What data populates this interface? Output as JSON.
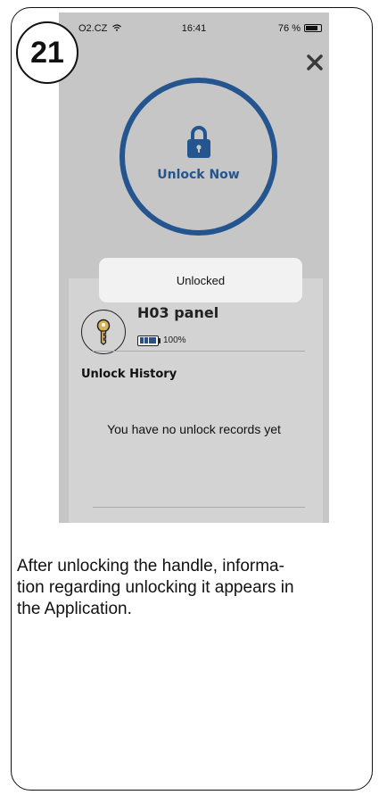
{
  "step": {
    "number": "21"
  },
  "status_bar": {
    "carrier": "O2.CZ",
    "time": "16:41",
    "battery": "76 %"
  },
  "unlock": {
    "label": "Unlock Now"
  },
  "toast": {
    "text": "Unlocked"
  },
  "device": {
    "name": "H03 panel",
    "battery_percent": "100%",
    "battery_level": 1.0
  },
  "history": {
    "title": "Unlock History",
    "empty_text": "You have no unlock records yet"
  },
  "caption": {
    "lines": [
      "After unlocking the handle, informa-",
      "tion regarding unlocking it appears in",
      "the Application."
    ]
  },
  "colors": {
    "accent": "#24558f",
    "screen_overlay": "#c6c6c6",
    "panel": "#d3d3d3",
    "toast": "#f2f2f2"
  },
  "icons": [
    "wifi-icon",
    "battery-icon",
    "close-icon",
    "lock-icon",
    "key-icon"
  ]
}
